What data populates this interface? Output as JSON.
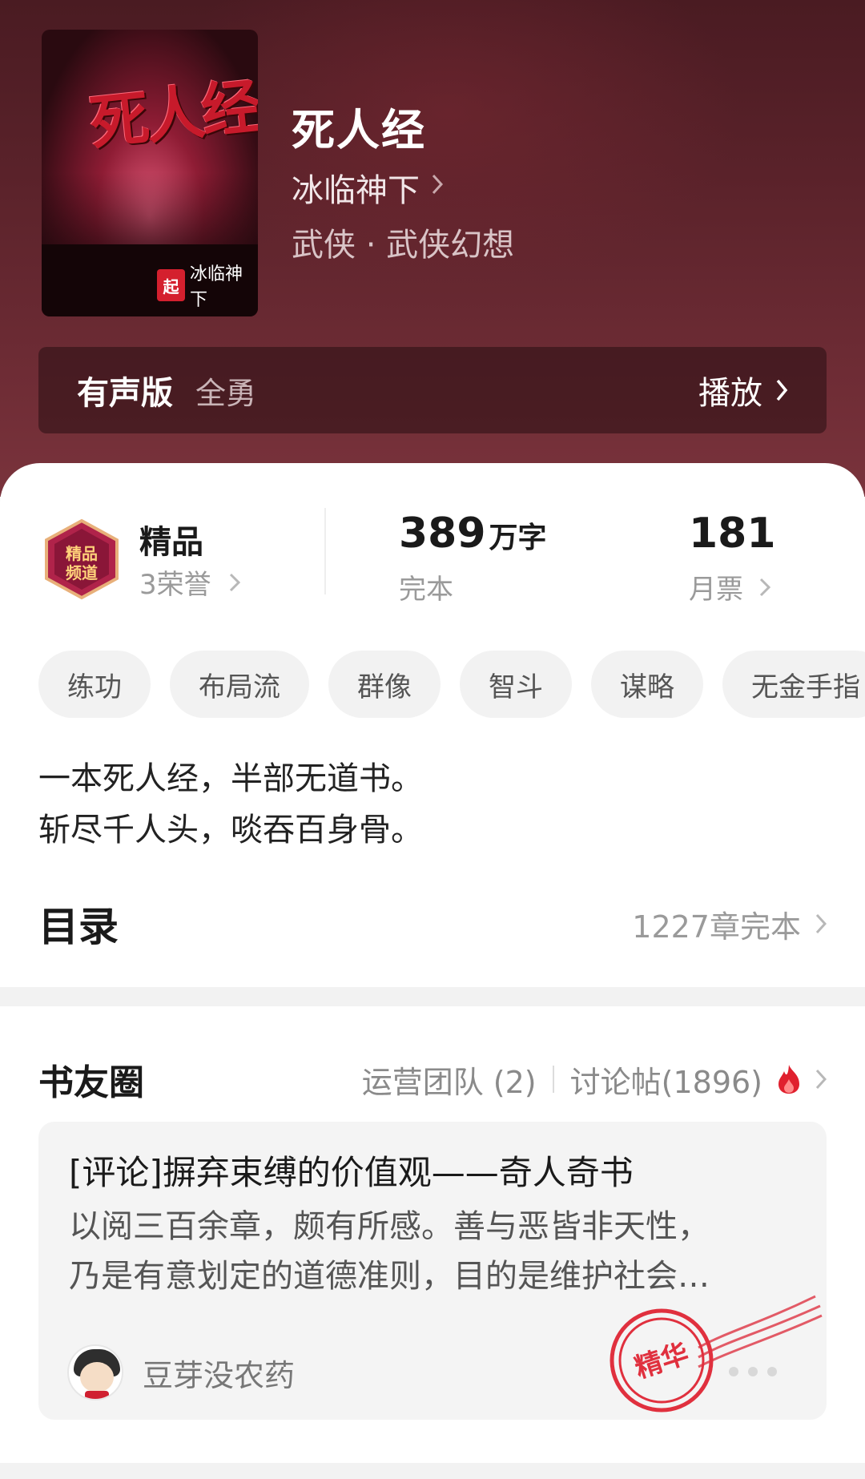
{
  "book": {
    "title": "死人经",
    "author": "冰临神下",
    "genre": "武侠 · 武侠幻想",
    "cover_art_text": "死人经",
    "cover_badge": "冰临神下",
    "cover_publisher_mark": "起点"
  },
  "audio": {
    "label": "有声版",
    "narrator": "全勇",
    "play_label": "播放"
  },
  "stats": {
    "honor_title": "精品",
    "honor_count": "3荣誉",
    "honor_badge_text": "精品频道",
    "words_num": "389",
    "words_unit": "万字",
    "status": "完本",
    "monthly_tickets": "181",
    "monthly_label": "月票"
  },
  "tags": [
    "练功",
    "布局流",
    "群像",
    "智斗",
    "谋略",
    "无金手指"
  ],
  "intro": [
    "一本死人经，半部无道书。",
    "斩尽千人头，啖吞百身骨。"
  ],
  "toc": {
    "title": "目录",
    "meta": "1227章完本"
  },
  "circle": {
    "title": "书友圈",
    "ops_team": "运营团队 (2)",
    "discussions": "讨论帖(1896)",
    "post": {
      "title": "[评论]摒弃束缚的价值观——奇人奇书",
      "body_line1": "以阅三百余章，颇有所感。善与恶皆非天性，",
      "body_line2": "乃是有意划定的道德准则，目的是维护社会…",
      "author": "豆芽没农药",
      "stamp": "精华"
    }
  },
  "colors": {
    "hero_bg": "#5a222a",
    "accent_red": "#e0202e",
    "muted": "#9a9a9a"
  }
}
